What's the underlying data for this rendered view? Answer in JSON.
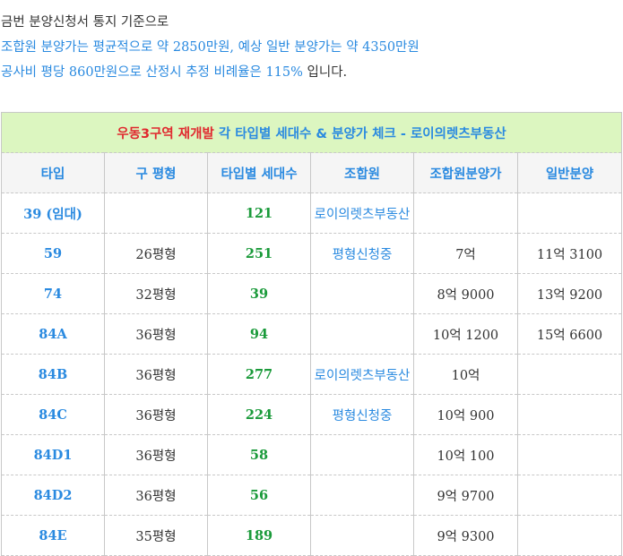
{
  "intro": {
    "line1": "금번 분양신청서 통지 기준으로",
    "line2": "조합원 분양가는 평균적으로 약 2850만원, 예상 일반 분양가는 약 4350만원",
    "line3_main": "공사비 평당 860만원으로 산정시 추정 비례율은 115%",
    "line3_tail": " 입니다."
  },
  "table": {
    "title_red": "우동3구역 재개발",
    "title_blue": " 각 타입별 세대수 & 분양가 체크 - 로이의렛츠부동산",
    "headers": [
      "타입",
      "구 평형",
      "타입별 세대수",
      "조합원",
      "조합원분양가",
      "일반분양"
    ],
    "rows": [
      {
        "type": "39 (임대)",
        "pyeong": "",
        "units": "121",
        "union": "로이의렛츠부동산",
        "union_price": "",
        "general_price": ""
      },
      {
        "type": "59",
        "pyeong": "26평형",
        "units": "251",
        "union": "평형신청중",
        "union_price": "7억",
        "general_price": "11억 3100"
      },
      {
        "type": "74",
        "pyeong": "32평형",
        "units": "39",
        "union": "",
        "union_price": "8억 9000",
        "general_price": "13억 9200"
      },
      {
        "type": "84A",
        "pyeong": "36평형",
        "units": "94",
        "union": "",
        "union_price": "10억 1200",
        "general_price": "15억 6600"
      },
      {
        "type": "84B",
        "pyeong": "36평형",
        "units": "277",
        "union": "로이의렛츠부동산",
        "union_price": "10억",
        "general_price": ""
      },
      {
        "type": "84C",
        "pyeong": "36평형",
        "units": "224",
        "union": "평형신청중",
        "union_price": "10억 900",
        "general_price": ""
      },
      {
        "type": "84D1",
        "pyeong": "36평형",
        "units": "58",
        "union": "",
        "union_price": "10억 100",
        "general_price": ""
      },
      {
        "type": "84D2",
        "pyeong": "36평형",
        "units": "56",
        "union": "",
        "union_price": "9억 9700",
        "general_price": ""
      },
      {
        "type": "84E",
        "pyeong": "35평형",
        "units": "189",
        "union": "",
        "union_price": "9억 9300",
        "general_price": ""
      }
    ]
  }
}
